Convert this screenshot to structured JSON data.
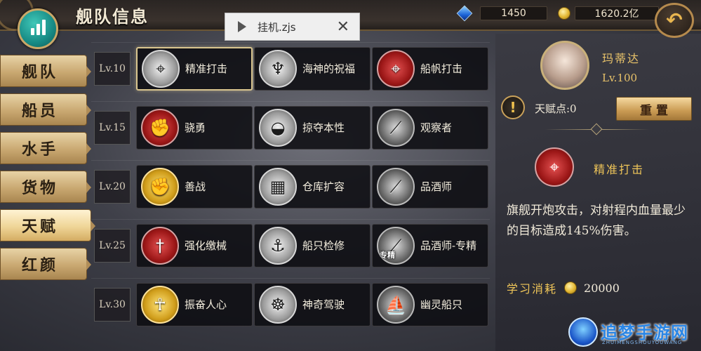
{
  "header": {
    "title": "舰队信息",
    "gems": "1450",
    "coins": "1620.2亿",
    "back_icon": "undo-arrow-icon"
  },
  "toast": {
    "filename": "挂机.zjs",
    "close_symbol": "✕"
  },
  "tabs": [
    {
      "label": "舰队",
      "active": false
    },
    {
      "label": "船员",
      "active": false
    },
    {
      "label": "水手",
      "active": false
    },
    {
      "label": "货物",
      "active": false
    },
    {
      "label": "天赋",
      "active": true
    },
    {
      "label": "红颜",
      "active": false
    }
  ],
  "talent_rows": [
    {
      "level": "Lv.10",
      "talents": [
        {
          "name": "精准打击",
          "icon": "crosshair-icon",
          "style": "gray",
          "selected": true
        },
        {
          "name": "海神的祝福",
          "icon": "sea-god-icon",
          "style": "gray"
        },
        {
          "name": "船帆打击",
          "icon": "sail-target-icon",
          "style": "red"
        }
      ]
    },
    {
      "level": "Lv.15",
      "talents": [
        {
          "name": "骁勇",
          "icon": "fist-icon",
          "style": "red"
        },
        {
          "name": "掠夺本性",
          "icon": "loot-bowl-icon",
          "style": "gray"
        },
        {
          "name": "观察者",
          "icon": "telescope-icon",
          "style": "dark"
        }
      ]
    },
    {
      "level": "Lv.20",
      "talents": [
        {
          "name": "善战",
          "icon": "fist-icon",
          "style": "gold"
        },
        {
          "name": "仓库扩容",
          "icon": "crates-icon",
          "style": "gray"
        },
        {
          "name": "品酒师",
          "icon": "wine-bottle-icon",
          "style": "dark"
        }
      ]
    },
    {
      "level": "Lv.25",
      "talents": [
        {
          "name": "强化缴械",
          "icon": "dagger-icon",
          "style": "red"
        },
        {
          "name": "船只检修",
          "icon": "ship-repair-icon",
          "style": "gray"
        },
        {
          "name": "品酒师-专精",
          "icon": "wine-bottle-icon",
          "style": "dark",
          "badge": "专精"
        }
      ]
    },
    {
      "level": "Lv.30",
      "talents": [
        {
          "name": "振奋人心",
          "icon": "cheer-figure-icon",
          "style": "gold"
        },
        {
          "name": "神奇驾驶",
          "icon": "ship-wheel-icon",
          "style": "gray"
        },
        {
          "name": "幽灵船只",
          "icon": "ghost-ship-icon",
          "style": "dark"
        }
      ]
    }
  ],
  "panel": {
    "character_name": "玛蒂达",
    "character_level": "Lv.100",
    "talent_points": "天赋点:0",
    "reset_label": "重置",
    "selected_talent": "精准打击",
    "description": "旗舰开炮攻击，对射程内血量最少的目标造成145%伤害。",
    "cost_label": "学习消耗",
    "cost_value": "20000"
  },
  "watermark": {
    "text": "追梦手游网",
    "sub": "ZHUIMENGSHOUYOUWANG"
  }
}
